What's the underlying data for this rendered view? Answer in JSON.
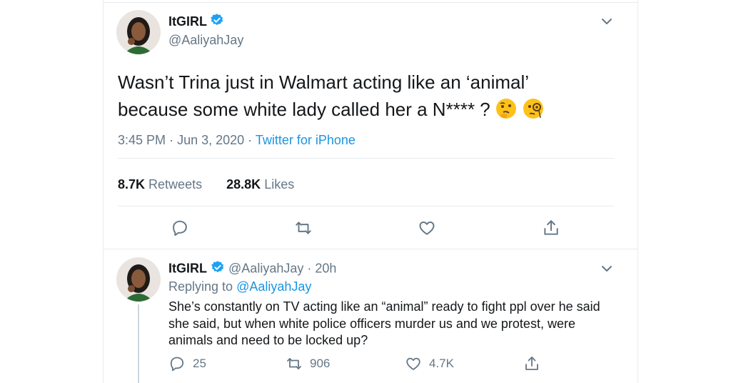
{
  "tweet": {
    "display_name": "ItGIRL",
    "handle": "@AaliyahJay",
    "text": "Wasn’t Trina just in Walmart acting like an ‘animal’ because some white lady called her a N**** ?",
    "emojis": [
      "thinking-face-emoji",
      "face-with-monocle-emoji"
    ],
    "time": "3:45 PM",
    "date": "Jun 3, 2020",
    "source": "Twitter for iPhone",
    "retweets_count": "8.7K",
    "retweets_label": "Retweets",
    "likes_count": "28.8K",
    "likes_label": "Likes"
  },
  "reply": {
    "display_name": "ItGIRL",
    "handle": "@AaliyahJay",
    "age": "20h",
    "replying_prefix": "Replying to",
    "replying_to": "@AaliyahJay",
    "text": "She’s constantly on TV acting like an “animal” ready to fight ppl over he said she said, but when white police officers murder us and we protest, were animals and need to be locked up?",
    "reply_count": "25",
    "retweet_count": "906",
    "like_count": "4.7K"
  },
  "colors": {
    "text": "#14171a",
    "secondary": "#657786",
    "link": "#1b95e0",
    "border": "#e6ecf0"
  },
  "separators": {
    "dot": "·"
  }
}
